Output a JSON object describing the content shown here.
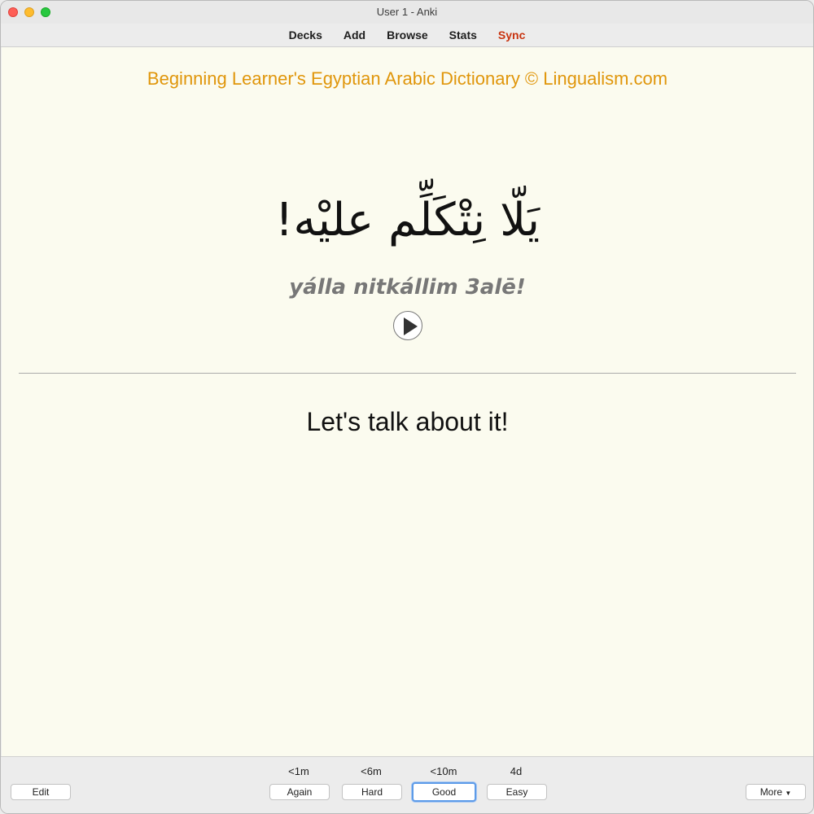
{
  "window": {
    "title": "User 1 - Anki"
  },
  "toolbar": {
    "decks": "Decks",
    "add": "Add",
    "browse": "Browse",
    "stats": "Stats",
    "sync": "Sync",
    "sync_color": "#c8320e"
  },
  "card": {
    "header": "Beginning Learner's Egyptian Arabic Dictionary © Lingualism.com",
    "arabic": "يَلّا نِتْكَلِّم عليْه!",
    "transliteration": "yálla nitkállim 3alē!",
    "english": "Let's talk about it!",
    "header_color": "#e0960b",
    "play_icon": "play-icon"
  },
  "answer_buttons": {
    "again": {
      "label": "Again",
      "interval": "<1m"
    },
    "hard": {
      "label": "Hard",
      "interval": "<6m"
    },
    "good": {
      "label": "Good",
      "interval": "<10m"
    },
    "easy": {
      "label": "Easy",
      "interval": "4d"
    }
  },
  "bottom": {
    "edit": "Edit",
    "more": "More",
    "more_icon": "chevron-down-icon"
  }
}
